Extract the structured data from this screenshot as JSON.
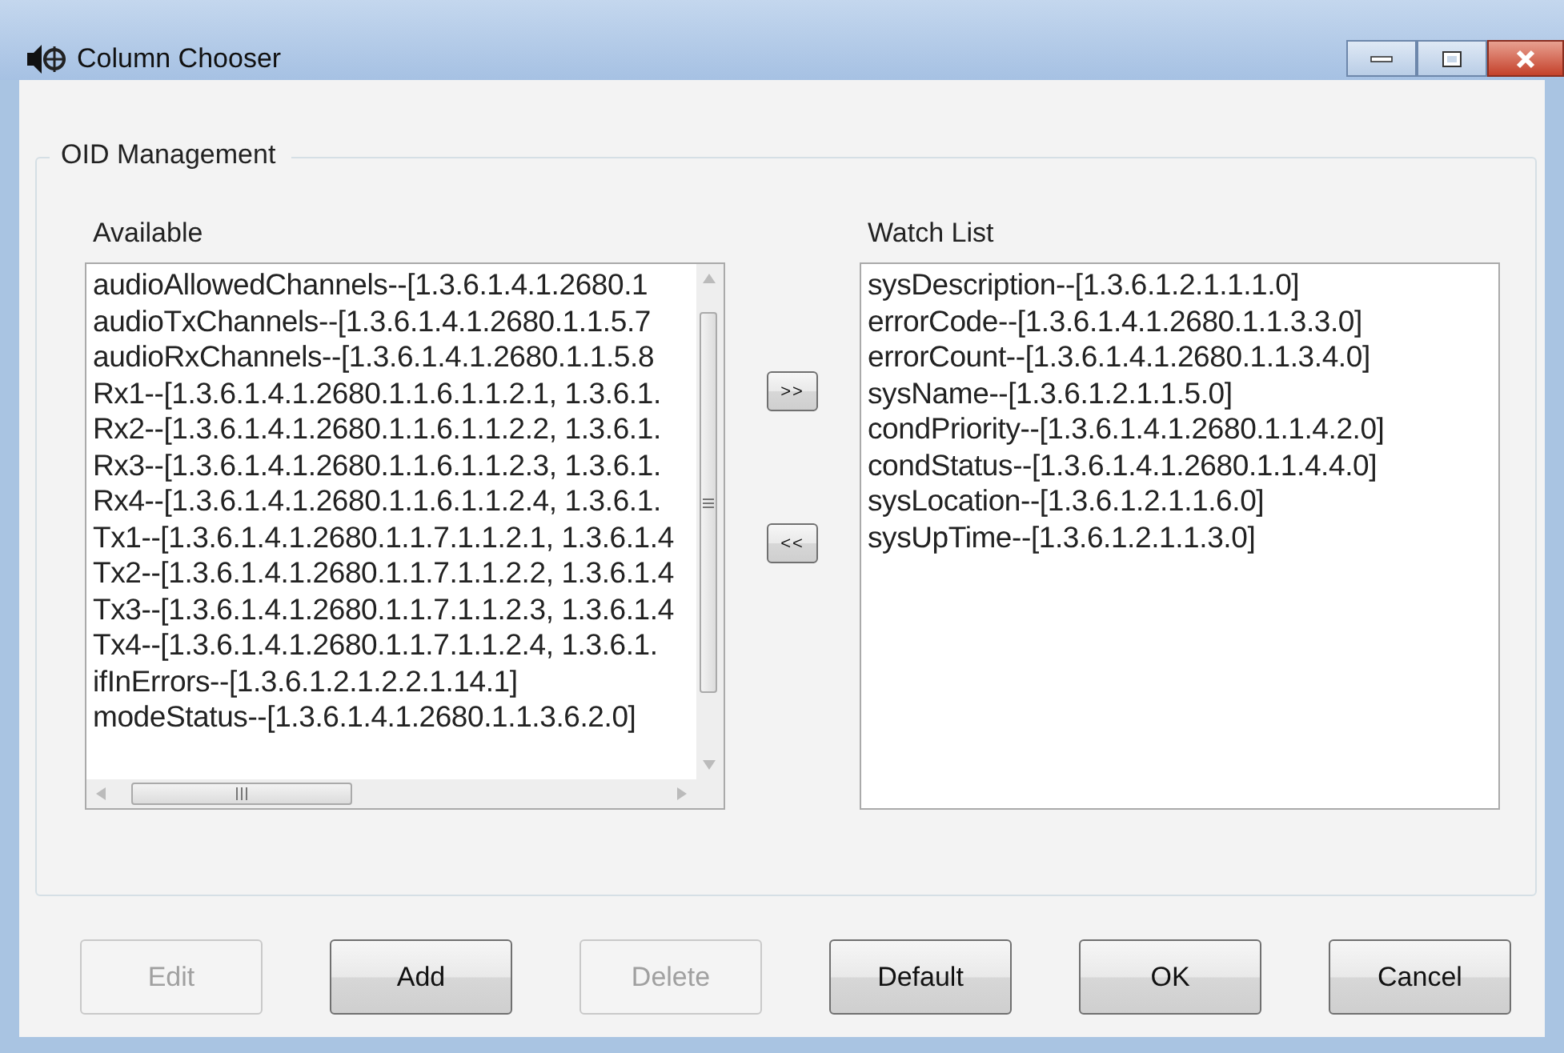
{
  "window": {
    "title": "Column Chooser"
  },
  "group": {
    "title": "OID Management"
  },
  "available": {
    "label": "Available",
    "items": [
      "audioAllowedChannels--[1.3.6.1.4.1.2680.1",
      "audioTxChannels--[1.3.6.1.4.1.2680.1.1.5.7",
      "audioRxChannels--[1.3.6.1.4.1.2680.1.1.5.8",
      "Rx1--[1.3.6.1.4.1.2680.1.1.6.1.1.2.1, 1.3.6.1.",
      "Rx2--[1.3.6.1.4.1.2680.1.1.6.1.1.2.2, 1.3.6.1.",
      "Rx3--[1.3.6.1.4.1.2680.1.1.6.1.1.2.3, 1.3.6.1.",
      "Rx4--[1.3.6.1.4.1.2680.1.1.6.1.1.2.4, 1.3.6.1.",
      "Tx1--[1.3.6.1.4.1.2680.1.1.7.1.1.2.1, 1.3.6.1.4",
      "Tx2--[1.3.6.1.4.1.2680.1.1.7.1.1.2.2, 1.3.6.1.4",
      "Tx3--[1.3.6.1.4.1.2680.1.1.7.1.1.2.3, 1.3.6.1.4",
      "Tx4--[1.3.6.1.4.1.2680.1.1.7.1.1.2.4, 1.3.6.1.",
      "ifInErrors--[1.3.6.1.2.1.2.2.1.14.1]",
      "modeStatus--[1.3.6.1.4.1.2680.1.1.3.6.2.0]"
    ]
  },
  "move_buttons": [
    ">>",
    "<<"
  ],
  "watch_list": {
    "label": "Watch List",
    "items": [
      "sysDescription--[1.3.6.1.2.1.1.1.0]",
      "errorCode--[1.3.6.1.4.1.2680.1.1.3.3.0]",
      "errorCount--[1.3.6.1.4.1.2680.1.1.3.4.0]",
      "sysName--[1.3.6.1.2.1.1.5.0]",
      "condPriority--[1.3.6.1.4.1.2680.1.1.4.2.0]",
      "condStatus--[1.3.6.1.4.1.2680.1.1.4.4.0]",
      "sysLocation--[1.3.6.1.2.1.1.6.0]",
      "sysUpTime--[1.3.6.1.2.1.1.3.0]"
    ]
  },
  "buttons": [
    {
      "label": "Edit",
      "disabled": true
    },
    {
      "label": "Add",
      "disabled": false
    },
    {
      "label": "Delete",
      "disabled": true
    },
    {
      "label": "Default",
      "disabled": false
    },
    {
      "label": "OK",
      "disabled": false
    },
    {
      "label": "Cancel",
      "disabled": false
    }
  ]
}
